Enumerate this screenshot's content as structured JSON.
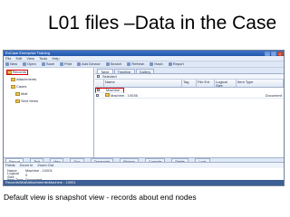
{
  "slide": {
    "title": "L01 files –Data in the Case",
    "caption": "Default view is snapshot view - records about end nodes"
  },
  "window": {
    "title": "EnCase Enterprise Training",
    "menu": [
      "File",
      "Edit",
      "View",
      "Tools",
      "Help"
    ],
    "toolbar": [
      "New",
      "Open",
      "Save",
      "Print",
      "Add Device",
      "Search",
      "Refresh",
      "Hash",
      "Report"
    ],
    "toolbar2": [
      "Home",
      "Entries",
      "Bookmarks",
      "Search Hits",
      "Records",
      "Devices",
      "Secure Storage",
      "Keywords"
    ]
  },
  "tree": {
    "items": [
      "Records",
      "Attachments",
      "Cases",
      "Mail",
      "Sent Items"
    ]
  },
  "right_pane": {
    "tabs": [
      "Table",
      "Timeline",
      "Gallery"
    ],
    "path_label": "Selected",
    "columns": [
      "Name",
      "Tag",
      "File Ext",
      "Logical Size",
      "Item Type"
    ],
    "rows": [
      {
        "name": "Machine - 10001",
        "item_type": "Document"
      },
      {
        "name": "Machine - 10036",
        "item_type": "Document"
      }
    ]
  },
  "bottom": {
    "tabs": [
      "Report",
      "Text",
      "Hex",
      "Doc",
      "Transcript",
      "Picture",
      "Console",
      "Fields",
      "Lock"
    ],
    "prop_toolbar": [
      "Fields",
      "Zoom In",
      "Zoom Out"
    ],
    "properties": [
      {
        "key": "Name",
        "value": "Machine - 10001"
      },
      {
        "key": "Logical Size",
        "value": "0"
      },
      {
        "key": "Item Type",
        "value": "Document"
      }
    ],
    "status": "Records\\Mail\\Attachments\\Machine - 10001"
  }
}
